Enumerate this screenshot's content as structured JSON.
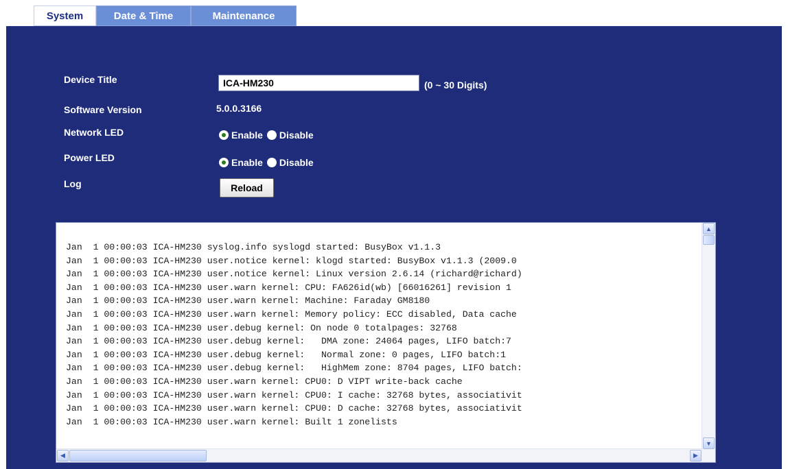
{
  "tabs": [
    {
      "label": "System",
      "active": true
    },
    {
      "label": "Date & Time",
      "active": false
    },
    {
      "label": "Maintenance",
      "active": false
    }
  ],
  "form": {
    "device_title_label": "Device Title",
    "device_title_value": "ICA-HM230",
    "device_title_hint": "(0 ~ 30 Digits)",
    "software_version_label": "Software Version",
    "software_version_value": "5.0.0.3166",
    "network_led_label": "Network LED",
    "network_led": {
      "enable_label": "Enable",
      "disable_label": "Disable",
      "selected": "Enable"
    },
    "power_led_label": "Power LED",
    "power_led": {
      "enable_label": "Enable",
      "disable_label": "Disable",
      "selected": "Enable"
    },
    "log_label": "Log",
    "reload_label": "Reload"
  },
  "log": {
    "lines": [
      "Jan  1 00:00:03 ICA-HM230 syslog.info syslogd started: BusyBox v1.1.3",
      "Jan  1 00:00:03 ICA-HM230 user.notice kernel: klogd started: BusyBox v1.1.3 (2009.0",
      "Jan  1 00:00:03 ICA-HM230 user.notice kernel: Linux version 2.6.14 (richard@richard)",
      "Jan  1 00:00:03 ICA-HM230 user.warn kernel: CPU: FA626id(wb) [66016261] revision 1",
      "Jan  1 00:00:03 ICA-HM230 user.warn kernel: Machine: Faraday GM8180",
      "Jan  1 00:00:03 ICA-HM230 user.warn kernel: Memory policy: ECC disabled, Data cache",
      "Jan  1 00:00:03 ICA-HM230 user.debug kernel: On node 0 totalpages: 32768",
      "Jan  1 00:00:03 ICA-HM230 user.debug kernel:   DMA zone: 24064 pages, LIFO batch:7",
      "Jan  1 00:00:03 ICA-HM230 user.debug kernel:   Normal zone: 0 pages, LIFO batch:1",
      "Jan  1 00:00:03 ICA-HM230 user.debug kernel:   HighMem zone: 8704 pages, LIFO batch:",
      "Jan  1 00:00:03 ICA-HM230 user.warn kernel: CPU0: D VIPT write-back cache",
      "Jan  1 00:00:03 ICA-HM230 user.warn kernel: CPU0: I cache: 32768 bytes, associativit",
      "Jan  1 00:00:03 ICA-HM230 user.warn kernel: CPU0: D cache: 32768 bytes, associativit",
      "Jan  1 00:00:03 ICA-HM230 user.warn kernel: Built 1 zonelists"
    ]
  },
  "colors": {
    "panel_bg": "#1e2c7a",
    "tab_inactive": "#6b8fd6",
    "radio_selected": "#2a7d1e"
  },
  "icons": {
    "scroll_up": "chevron-up-icon",
    "scroll_down": "chevron-down-icon",
    "scroll_left": "chevron-left-icon",
    "scroll_right": "chevron-right-icon"
  }
}
